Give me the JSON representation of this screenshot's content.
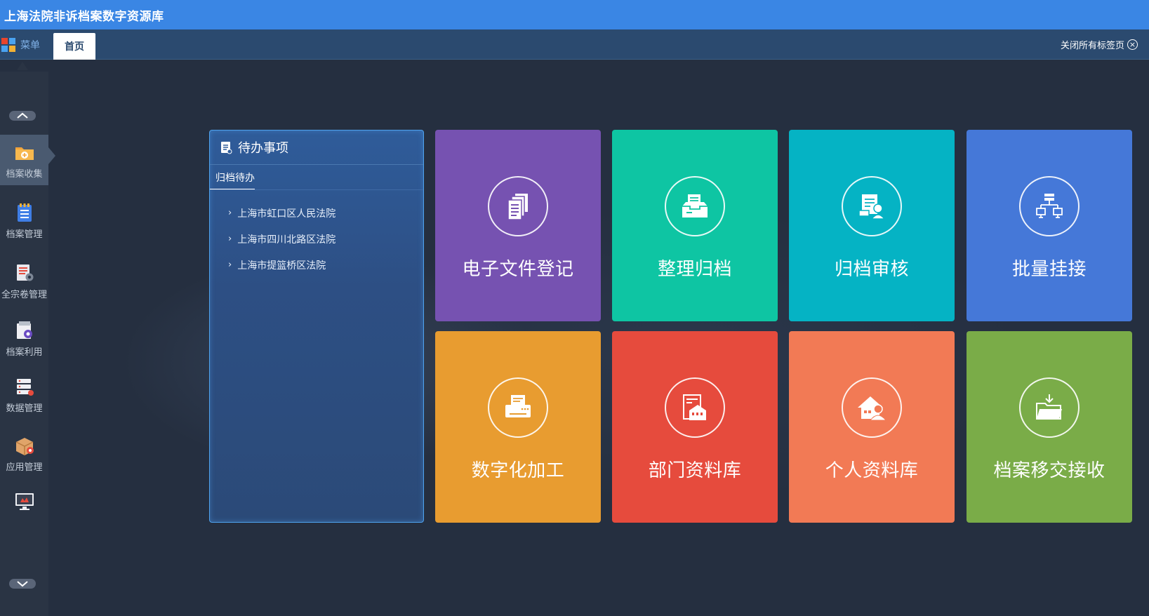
{
  "app": {
    "title": "上海法院非诉档案数字资源库"
  },
  "tabbar": {
    "menu_label": "菜单",
    "tabs": [
      {
        "label": "首页",
        "active": true
      }
    ],
    "close_all_label": "关闭所有标签页"
  },
  "sidebar": {
    "items": [
      {
        "label": "档案收集",
        "icon": "folder-add-icon",
        "active": true
      },
      {
        "label": "档案管理",
        "icon": "clipboard-list-icon",
        "active": false
      },
      {
        "label": "全宗卷管理",
        "icon": "document-gear-icon",
        "active": false
      },
      {
        "label": "档案利用",
        "icon": "file-search-icon",
        "active": false
      },
      {
        "label": "数据管理",
        "icon": "server-icon",
        "active": false
      },
      {
        "label": "应用管理",
        "icon": "package-gear-icon",
        "active": false
      },
      {
        "label": "",
        "icon": "monitor-icon",
        "active": false
      }
    ]
  },
  "todo": {
    "title": "待办事项",
    "section": "归档待办",
    "items": [
      "上海市虹口区人民法院",
      "上海市四川北路区法院",
      "上海市提篮桥区法院"
    ]
  },
  "tiles": [
    {
      "label": "电子文件登记",
      "color": "#7652b1",
      "icon": "documents-stack-icon"
    },
    {
      "label": "整理归档",
      "color": "#0ec5a3",
      "icon": "inbox-tray-icon"
    },
    {
      "label": "归档审核",
      "color": "#05b3c4",
      "icon": "file-user-icon"
    },
    {
      "label": "批量挂接",
      "color": "#4578d8",
      "icon": "network-icon"
    },
    {
      "label": "数字化加工",
      "color": "#e89c30",
      "icon": "printer-icon"
    },
    {
      "label": "部门资料库",
      "color": "#e64b3d",
      "icon": "department-icon"
    },
    {
      "label": "个人资料库",
      "color": "#f27a55",
      "icon": "home-user-icon"
    },
    {
      "label": "档案移交接收",
      "color": "#7aac48",
      "icon": "folder-download-icon"
    }
  ]
}
